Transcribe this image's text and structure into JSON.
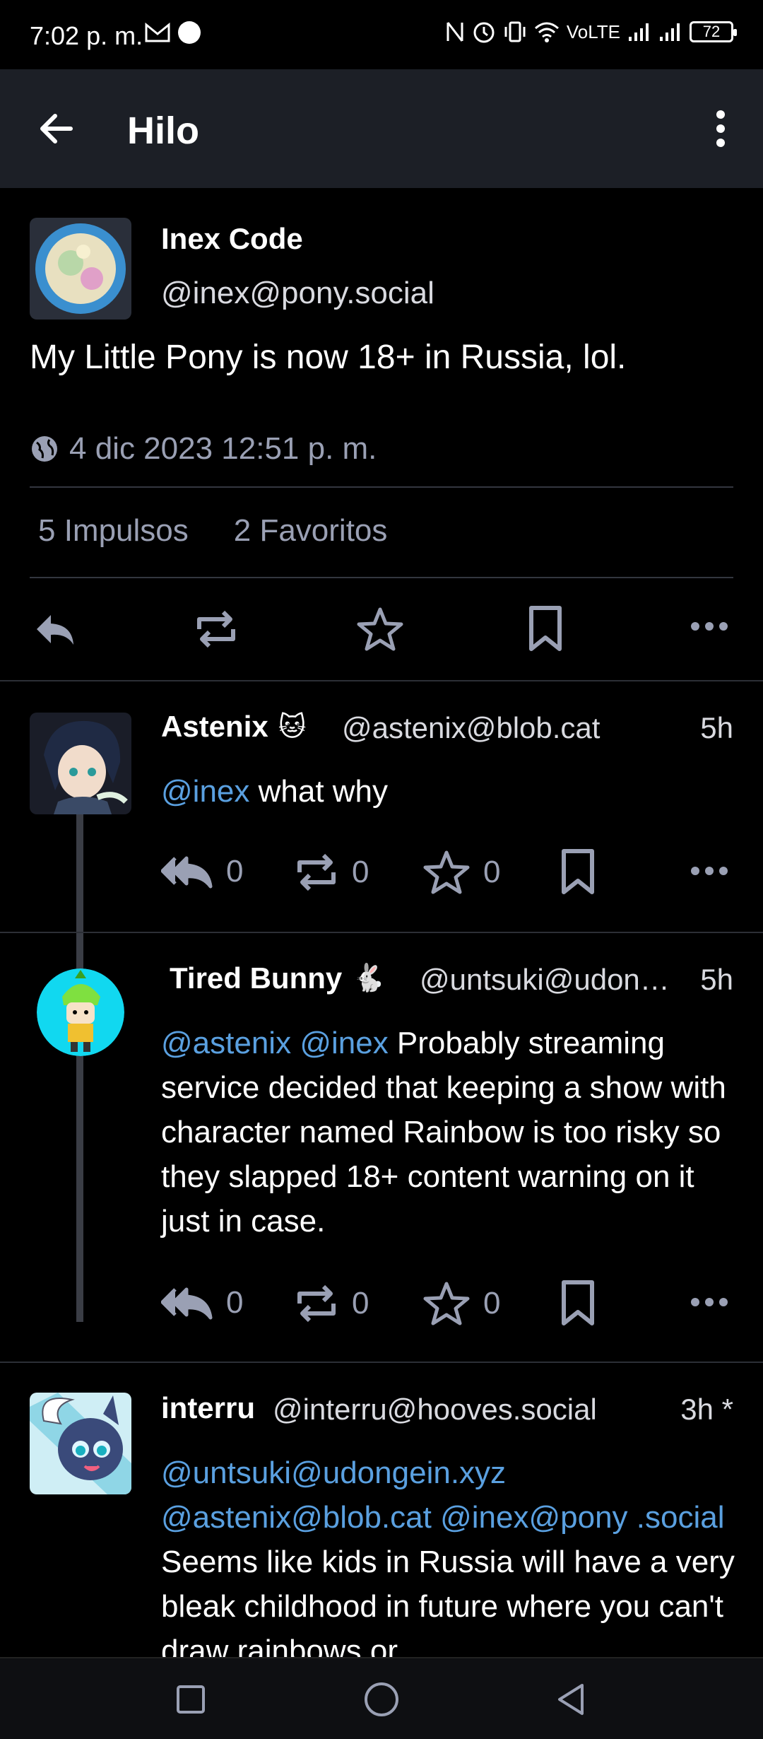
{
  "status_bar": {
    "time": "7:02 p. m.",
    "battery": "72",
    "network": "VoLTE"
  },
  "app_bar": {
    "title": "Hilo"
  },
  "main_post": {
    "author_name": "Inex Code",
    "author_handle": "@inex@pony.social",
    "text": "My Little Pony is now 18+ in Russia, lol.",
    "date": "4 dic 2023 12:51 p. m.",
    "boosts": "5 Impulsos",
    "favorites": "2 Favoritos"
  },
  "replies": [
    {
      "name": "Astenix",
      "emoji": "🐱",
      "handle": "@astenix@blob.cat",
      "time": "5h",
      "mentions": [
        "@inex"
      ],
      "text": " what why",
      "reply_count": "0",
      "boost_count": "0",
      "fav_count": "0"
    },
    {
      "name": "Tired Bunny",
      "emoji": "🐇",
      "handle": "@untsuki@udon…",
      "time": "5h",
      "mentions": [
        "@astenix",
        "@inex"
      ],
      "text": " Probably streaming service decided that keeping a show with character named Rainbow is too risky so they slapped 18+ content warning on it just in case.",
      "reply_count": "0",
      "boost_count": "0",
      "fav_count": "0"
    },
    {
      "name": "interru",
      "handle": "@interru@hooves.social",
      "time": "3h *",
      "mentions": [
        "@untsuki@udongein.xyz",
        "@astenix@blob.cat",
        "@inex@pony .social"
      ],
      "text": " Seems like kids in Russia will have a very bleak childhood in future where you can't draw rainbows or"
    }
  ],
  "colors": {
    "background": "#000000",
    "appbar": "#1c1f26",
    "mention": "#5aa0e0",
    "muted": "#9aa0b4"
  },
  "icons": {
    "back": "arrow-left-icon",
    "menu": "more-vertical-icon",
    "globe": "globe-icon",
    "reply": "reply-icon",
    "reply_all": "reply-all-icon",
    "boost": "repeat-icon",
    "favorite": "star-icon",
    "bookmark": "bookmark-icon",
    "more": "more-horizontal-icon"
  }
}
